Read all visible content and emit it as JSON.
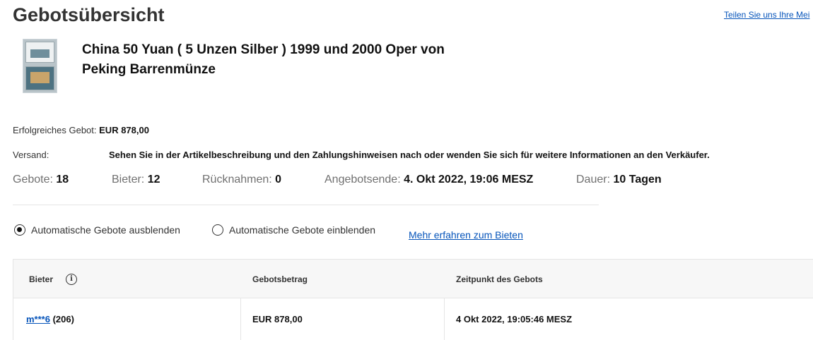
{
  "header": {
    "title": "Gebotsübersicht",
    "feedback_link": "Teilen Sie uns Ihre Mei"
  },
  "item": {
    "title": "China 50 Yuan ( 5 Unzen Silber ) 1999 und 2000 Oper von Peking Barrenmünze"
  },
  "summary": {
    "winning_bid_label": "Erfolgreiches Gebot:",
    "winning_bid_value": "EUR 878,00",
    "shipping_label": "Versand:",
    "shipping_value": "Sehen Sie in der Artikelbeschreibung und den Zahlungshinweisen nach oder wenden Sie sich für weitere Informationen an den Verkäufer."
  },
  "stats": {
    "bids_label": "Gebote:",
    "bids_value": "18",
    "bidders_label": "Bieter:",
    "bidders_value": "12",
    "retractions_label": "Rücknahmen:",
    "retractions_value": "0",
    "end_label": "Angebotsende:",
    "end_value": "4. Okt 2022, 19:06 MESZ",
    "duration_label": "Dauer:",
    "duration_value": "10 Tagen"
  },
  "filters": {
    "hide_auto": "Automatische Gebote ausblenden",
    "show_auto": "Automatische Gebote einblenden",
    "selected": "hide_auto",
    "learn_more": "Mehr erfahren zum Bieten"
  },
  "table": {
    "columns": [
      "Bieter",
      "Gebotsbetrag",
      "Zeitpunkt des Gebots"
    ],
    "rows": [
      {
        "bidder": "m***6",
        "feedback": "(206)",
        "amount": "EUR 878,00",
        "time": "4 Okt 2022, 19:05:46 MESZ"
      }
    ]
  }
}
